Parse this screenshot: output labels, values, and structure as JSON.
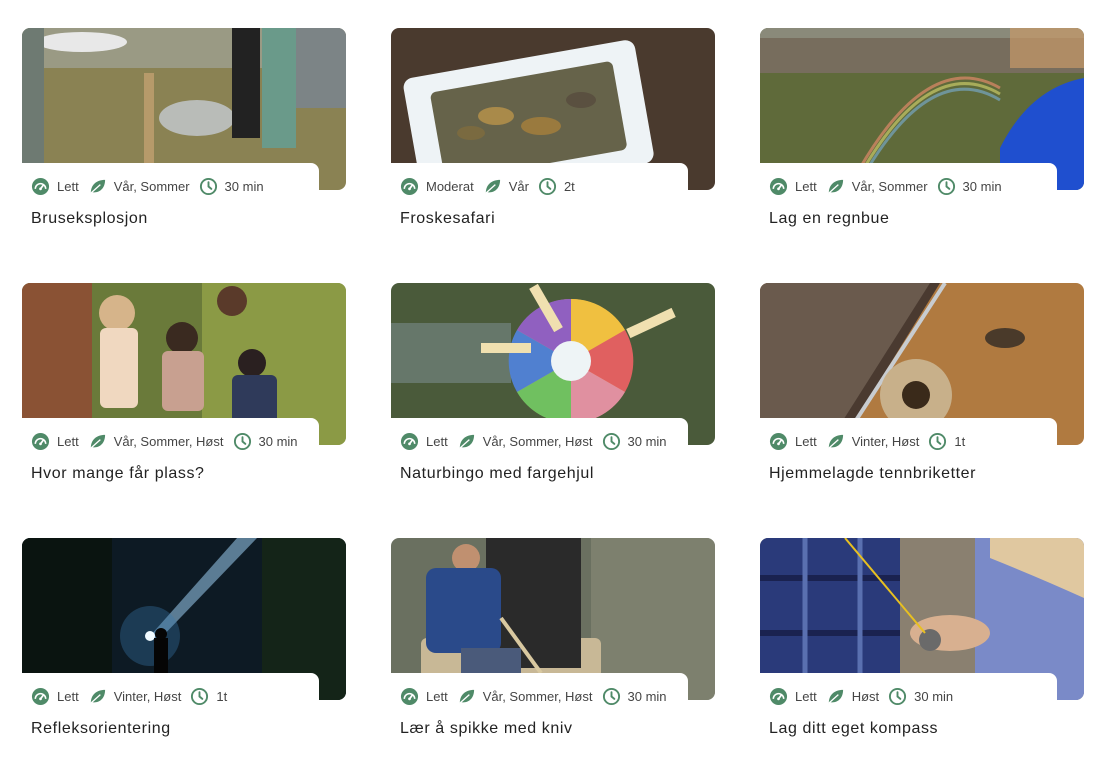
{
  "accent_color": "#4f8a68",
  "icons": {
    "difficulty": "gauge-icon",
    "season": "leaf-icon",
    "duration": "clock-icon"
  },
  "activities": [
    {
      "title": "Bruseksplosjon",
      "difficulty": "Lett",
      "season": "Vår, Sommer",
      "duration": "30 min",
      "image": "children-in-garden-soda-fountain"
    },
    {
      "title": "Froskesafari",
      "difficulty": "Moderat",
      "season": "Vår",
      "duration": "2t",
      "image": "frogs-in-plastic-tub"
    },
    {
      "title": "Lag en regnbue",
      "difficulty": "Lett",
      "season": "Vår, Sommer",
      "duration": "30 min",
      "image": "rainbow-in-garden-spray"
    },
    {
      "title": "Hvor mange får plass?",
      "difficulty": "Lett",
      "season": "Vår, Sommer, Høst",
      "duration": "30 min",
      "image": "children-hugging-tree"
    },
    {
      "title": "Naturbingo med fargehjul",
      "difficulty": "Lett",
      "season": "Vår, Sommer, Høst",
      "duration": "30 min",
      "image": "color-wheel-with-clothespins"
    },
    {
      "title": "Hjemmelagde tennbriketter",
      "difficulty": "Lett",
      "season": "Vinter, Høst",
      "duration": "1t",
      "image": "paper-shreds-and-twine"
    },
    {
      "title": "Refleksorientering",
      "difficulty": "Lett",
      "season": "Vinter, Høst",
      "duration": "1t",
      "image": "person-with-flashlight-in-forest"
    },
    {
      "title": "Lær å spikke med kniv",
      "difficulty": "Lett",
      "season": "Vår, Sommer, Høst",
      "duration": "30 min",
      "image": "child-whittling-stick"
    },
    {
      "title": "Lag ditt eget kompass",
      "difficulty": "Lett",
      "season": "Høst",
      "duration": "30 min",
      "image": "children-holding-compass"
    }
  ]
}
